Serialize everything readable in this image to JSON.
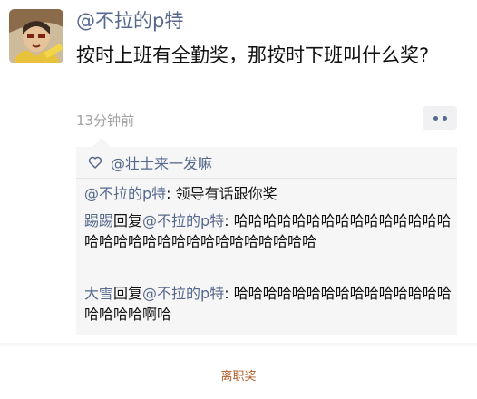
{
  "post": {
    "author": "@不拉的p特",
    "text": "按时上班有全勤奖，那按时下班叫什么奖?",
    "time": "13分钟前"
  },
  "likes": {
    "names": "@壮士来一发嘛"
  },
  "comments": [
    {
      "author": "@不拉的p特",
      "sep": ": ",
      "text": "领导有话跟你奖"
    },
    {
      "author": "踢踢",
      "reply": "回复",
      "target": "@不拉的p特",
      "sep": ": ",
      "text": "哈哈哈哈哈哈哈哈哈哈哈哈哈哈哈哈哈哈哈哈哈哈哈哈哈哈哈哈哈哈哈"
    },
    {
      "author": "大雪",
      "reply": "回复",
      "target": "@不拉的p特",
      "sep": ": ",
      "text": "哈哈哈哈哈哈哈哈哈哈哈哈哈哈哈哈哈哈哈啊哈"
    }
  ],
  "caption": "离职奖",
  "icons": {
    "more": "more-dots-icon",
    "like": "heart-icon",
    "avatar": "avatar-image"
  },
  "colors": {
    "link": "#56688c",
    "caption": "#b05a28",
    "comment_bg": "#f6f6f6"
  }
}
